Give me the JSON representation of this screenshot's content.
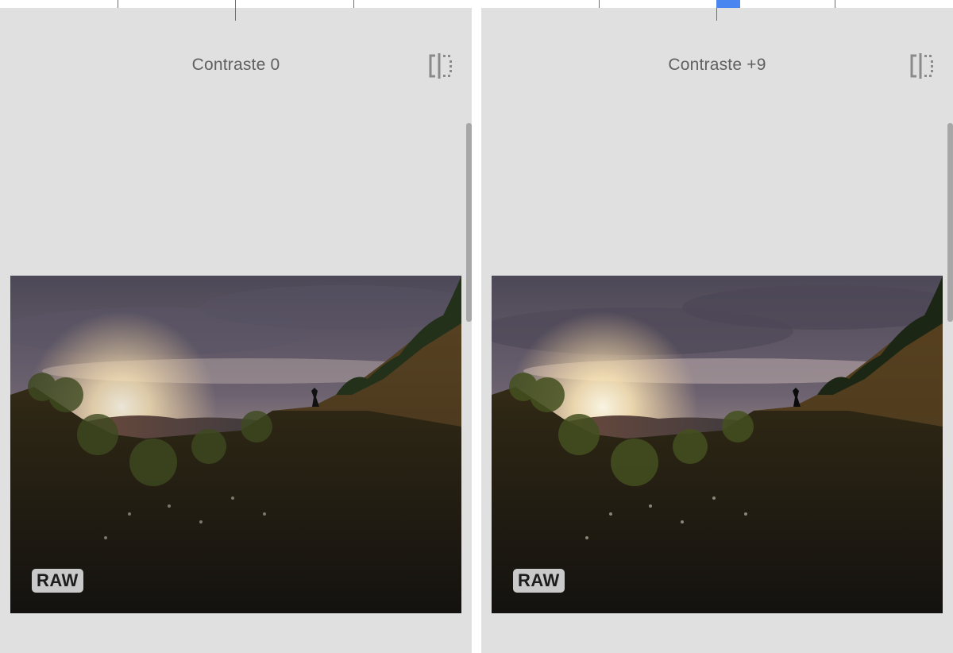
{
  "panels": [
    {
      "title": "Contraste 0",
      "badge": "RAW",
      "compare_icon": "compare-split-icon",
      "slider_active": false
    },
    {
      "title": "Contraste +9",
      "badge": "RAW",
      "compare_icon": "compare-split-icon",
      "slider_active": true
    }
  ],
  "colors": {
    "background": "#e0e0e0",
    "slider_accent": "#4a86f0",
    "text": "#606060"
  }
}
